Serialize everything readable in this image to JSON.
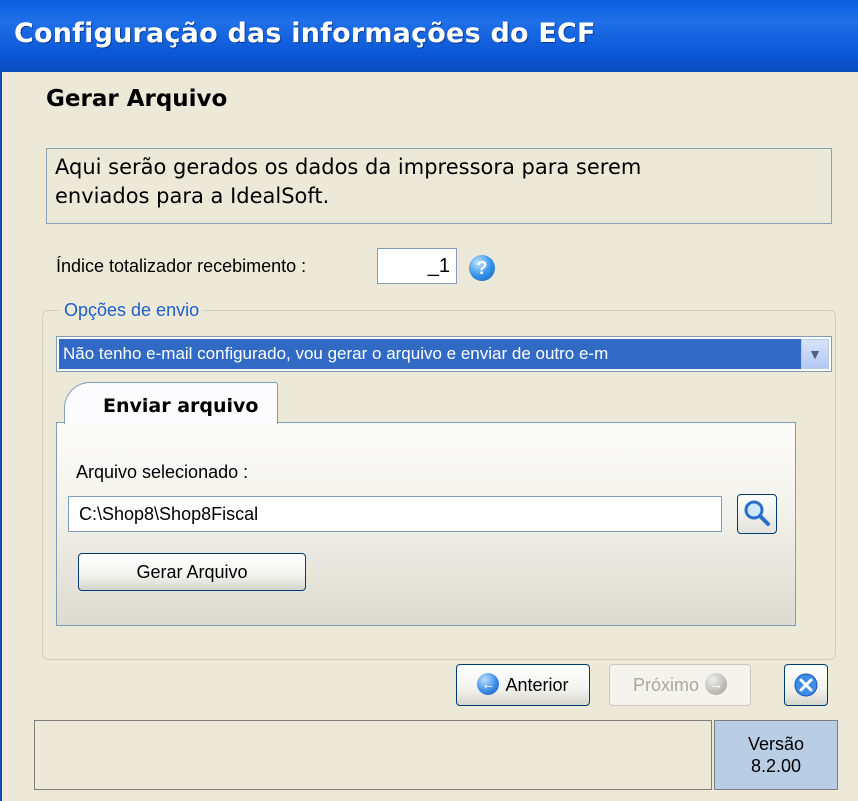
{
  "window": {
    "title": "Configuração das informações do ECF"
  },
  "step": {
    "title": "Gerar Arquivo",
    "description_line1": "Aqui serão gerados os dados da impressora para serem",
    "description_line2": "enviados para a IdealSoft."
  },
  "indice": {
    "label": "Índice totalizador recebimento :",
    "value": "_1",
    "help_icon": "help-icon"
  },
  "opcoes": {
    "legend": "Opções de envio",
    "selected": "Não tenho e-mail configurado, vou gerar o arquivo e enviar de outro e-m"
  },
  "tabs": [
    {
      "label": "Enviar arquivo",
      "active": true
    }
  ],
  "arquivo": {
    "label": "Arquivo selecionado :",
    "path": "C:\\Shop8\\Shop8Fiscal",
    "search_icon": "magnifier-icon",
    "gerar_label": "Gerar Arquivo"
  },
  "nav": {
    "anterior_label": "Anterior",
    "proximo_label": "Próximo",
    "proximo_enabled": false,
    "close_icon": "close-icon"
  },
  "status": {
    "versao_label": "Versão",
    "versao_value": "8.2.00"
  }
}
